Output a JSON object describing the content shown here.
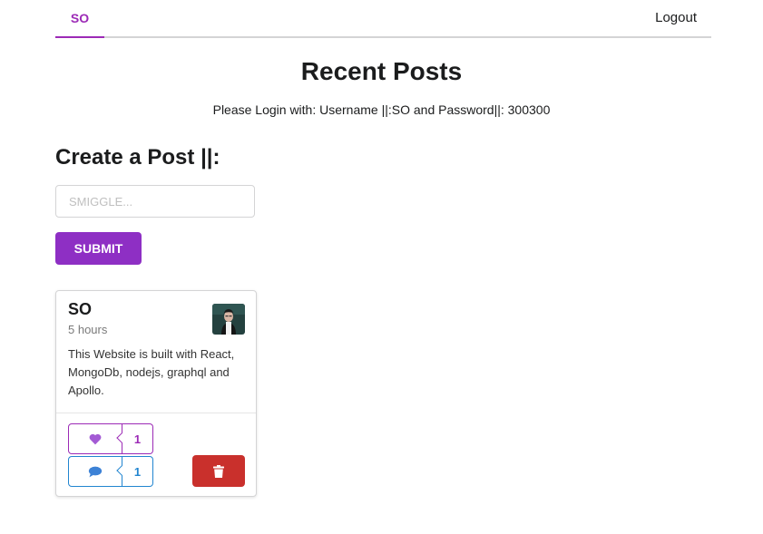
{
  "nav": {
    "home_label": "SO",
    "logout_label": "Logout"
  },
  "page": {
    "title": "Recent Posts",
    "login_hint": "Please Login with: Username ||:SO and Password||: 300300"
  },
  "post_form": {
    "title": "Create a Post ||:",
    "input_placeholder": "SMIGGLE...",
    "input_value": "",
    "submit_label": "SUBMIT"
  },
  "posts": [
    {
      "author": "SO",
      "time": "5 hours",
      "body": "This Website is built with React, MongoDb, nodejs, graphql and Apollo.",
      "like_count": "1",
      "comment_count": "1",
      "like_icon": "heart-icon",
      "comment_icon": "comment-icon",
      "delete_icon": "trash-icon"
    }
  ],
  "colors": {
    "accent": "#9c2ab6",
    "submit": "#8e2fc4",
    "comment": "#2185d0",
    "delete": "#c9302c"
  }
}
